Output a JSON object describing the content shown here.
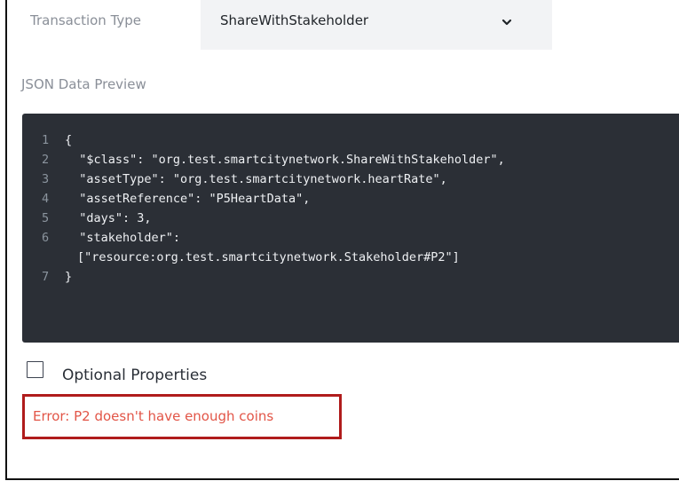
{
  "transaction": {
    "label": "Transaction Type",
    "selected": "ShareWithStakeholder"
  },
  "json_preview": {
    "label": "JSON Data Preview",
    "lines": [
      {
        "num": "1",
        "text": "{"
      },
      {
        "num": "2",
        "text": "  \"$class\": \"org.test.smartcitynetwork.ShareWithStakeholder\","
      },
      {
        "num": "3",
        "text": "  \"assetType\": \"org.test.smartcitynetwork.heartRate\","
      },
      {
        "num": "4",
        "text": "  \"assetReference\": \"P5HeartData\","
      },
      {
        "num": "5",
        "text": "  \"days\": 3,"
      },
      {
        "num": "6",
        "text": "  \"stakeholder\":"
      },
      {
        "num": "",
        "text": "[\"resource:org.test.smartcitynetwork.Stakeholder#P2\"]"
      },
      {
        "num": "7",
        "text": "}"
      }
    ]
  },
  "optional_properties": {
    "label": "Optional Properties",
    "checked": false
  },
  "error": {
    "message": "Error: P2 doesn't have enough coins"
  },
  "colors": {
    "code_background": "#2b2f36",
    "error_border": "#b01c1c",
    "error_text": "#e25547"
  },
  "icons": {
    "dropdown": "chevron-down-icon"
  }
}
